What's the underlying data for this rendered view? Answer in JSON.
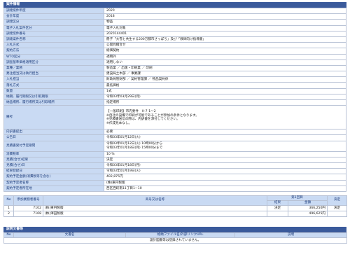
{
  "info": {
    "header": "案件情報",
    "rows": [
      {
        "k": "調達案件年度",
        "v": "2020"
      },
      {
        "k": "会計年度",
        "v": "2018"
      },
      {
        "k": "調達区分",
        "v": "物品"
      },
      {
        "k": "電子入札案件区分",
        "v": "電子入札対象"
      },
      {
        "k": "調達案件番号",
        "v": "2020144401"
      },
      {
        "k": "調達案件名称",
        "v": "冊子「大雪と共生する200万都市さっぽろ」及び「教師向け指導書」"
      },
      {
        "k": "入札方式",
        "v": "公開見積合せ"
      },
      {
        "k": "契約方法",
        "v": "総価契約"
      },
      {
        "k": "WTO区分",
        "v": "適用外"
      },
      {
        "k": "調査基準価格適用区分",
        "v": "適用しない"
      },
      {
        "k": "業種／業務",
        "v": "製造業 ／ 出版・印刷業 ／ 印刷"
      },
      {
        "k": "発注担当又は執行担当",
        "v": "建設局土木部 ／ 事業課"
      },
      {
        "k": "入札担当",
        "v": "財政局管財部 ／ 契約管理課 ／ 物品契約係"
      },
      {
        "k": "落札方式",
        "v": "最低価格"
      },
      {
        "k": "数量",
        "v": "1式"
      },
      {
        "k": "納期、履行期限又は引取期限",
        "v": "令和03年03月29日(月)"
      },
      {
        "k": "納品場所、履行場所又は引取場所",
        "v": "指定場所"
      }
    ],
    "notes_key": "備考",
    "notes_lines": [
      "【一般印刷】市内要件　H-7-1～2",
      "※自社の設備で印刷が可能であることが参加の条件となります。",
      "※見積書送信の際は、内訳書を添付してください。",
      "※作成見本なし。"
    ],
    "rows2": [
      {
        "k": "内訳書提出",
        "v": "必要"
      },
      {
        "k": "公告日",
        "v": "令和03年01月12日(火)"
      }
    ],
    "period_key": "見積書受付予定期間",
    "period_lines": [
      "令和03年01月12日(火) 10時00分から",
      "令和03年01月18日(月) 15時00分まで"
    ],
    "rows3": [
      {
        "k": "消費税率",
        "v": "10 %"
      },
      {
        "k": "見積(合せ)結果",
        "v": "決定"
      },
      {
        "k": "見積(合せ)日",
        "v": "令和03年01月18日(月)"
      },
      {
        "k": "結果登録日",
        "v": "令和03年01月19日(火)"
      },
      {
        "k": "契約予定金額(消費税等を含む)",
        "v": "402,875円"
      },
      {
        "k": "契約予定者名称",
        "v": "(株)東円製版"
      },
      {
        "k": "契約予定者所在地",
        "v": "西区西町南11丁目1−10"
      }
    ]
  },
  "result": {
    "headers": {
      "no": "No",
      "number": "参加業務者番号",
      "name": "商号又は名称",
      "round1": "第1回目",
      "status": "結果",
      "amount": "金額",
      "decision": "決定"
    },
    "rows": [
      {
        "no": "1",
        "number": "7102",
        "name": "(株)東円製版",
        "status": "決定",
        "amount": "366,250円",
        "decision": "決定"
      },
      {
        "no": "2",
        "number": "7168",
        "name": "(株)澤田製版",
        "status": "",
        "amount": "496,625円",
        "decision": ""
      }
    ]
  },
  "docs": {
    "header": "説明文書等",
    "headers": {
      "no": "No",
      "name": "文書名",
      "file": "格納ファイル名/外部リンクURL",
      "desc": "説明"
    },
    "empty_message": "設計図書等は登録されていません。"
  }
}
